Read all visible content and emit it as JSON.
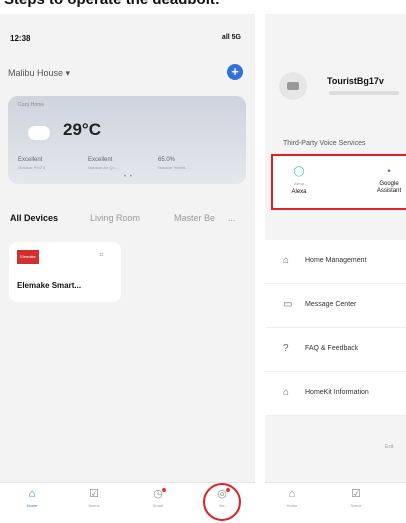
{
  "header": {
    "title": "Steps to operate the deadbolt:"
  },
  "left": {
    "status_time": "12:38",
    "status_signal": "all 5G",
    "home_name": "Malibu House",
    "add_label": "+",
    "weather": {
      "label": "Cozy Home",
      "temp": "29°C",
      "stats": [
        {
          "value": "Excellent",
          "sub": "Outdoor PM2.5"
        },
        {
          "value": "Excellent",
          "sub": "Outdoor Air Qu..."
        },
        {
          "value": "65.0%",
          "sub": "Outdoor Humid..."
        }
      ]
    },
    "tabs": [
      "All Devices",
      "Living Room",
      "Master Be",
      "..."
    ],
    "device": {
      "logo": "Elemake",
      "name": "Elemake Smart..."
    },
    "tabbar": [
      {
        "label": "Home",
        "icon": "home-icon",
        "glyph": "⌂",
        "active": true
      },
      {
        "label": "Scene",
        "icon": "scene-icon",
        "glyph": "☑",
        "active": false
      },
      {
        "label": "Smart",
        "icon": "smart-icon",
        "glyph": "◷",
        "active": false
      },
      {
        "label": "Me",
        "icon": "me-icon",
        "glyph": "◎",
        "active": false
      }
    ]
  },
  "right": {
    "user_name": "TouristBg17v",
    "section_title": "Third-Party Voice Services",
    "voice": [
      {
        "label_top": "Alexa",
        "label": "Alexa",
        "icon": "alexa-icon",
        "glyph": "◯"
      },
      {
        "label_top": "",
        "label": "Google Assistant",
        "icon": "google-assistant-icon",
        "glyph": "•"
      }
    ],
    "menu": [
      {
        "label": "Home Management",
        "icon": "home-management-icon",
        "glyph": "⌂"
      },
      {
        "label": "Message Center",
        "icon": "message-center-icon",
        "glyph": "▭"
      },
      {
        "label": "FAQ & Feedback",
        "icon": "faq-icon",
        "glyph": "?"
      },
      {
        "label": "HomeKit Information",
        "icon": "homekit-icon",
        "glyph": "⌂"
      }
    ],
    "exit": "Exit",
    "tabbar": [
      {
        "label": "Home",
        "icon": "home-icon",
        "glyph": "⌂"
      },
      {
        "label": "Scene",
        "icon": "scene-icon",
        "glyph": "☑"
      }
    ]
  },
  "colors": {
    "accent": "#2f6fe0",
    "highlight": "#e21f26",
    "badge": "#e53935"
  }
}
